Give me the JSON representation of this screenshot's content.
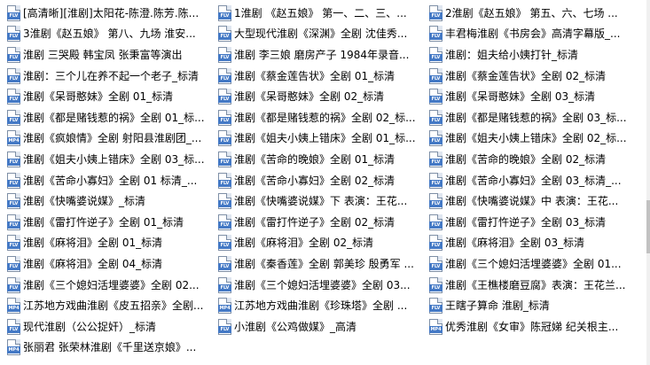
{
  "files": [
    {
      "name": "[高清晰][淮剧]太阳花-陈澄.陈芳.陈...",
      "type": "FLV"
    },
    {
      "name": "1淮剧 《赵五娘》 第一、二、三、...",
      "type": "FLV"
    },
    {
      "name": "2淮剧《赵五娘》 第五、六、七场 ...",
      "type": "FLV"
    },
    {
      "name": "3淮剧《赵五娘》 第八、九场 淮安...",
      "type": "FLV"
    },
    {
      "name": "大型现代淮剧《深渊》全剧 沈佳秀...",
      "type": "FLV"
    },
    {
      "name": "丰君梅淮剧《书房会》高清字幕版_...",
      "type": "FLV"
    },
    {
      "name": "淮剧 三哭殿 韩宝凤 张秉富等演出",
      "type": "FLV"
    },
    {
      "name": "淮剧 李三娘 磨房产子 1984年录音...",
      "type": "FLV"
    },
    {
      "name": "淮剧：姐夫给小姨打针_标清",
      "type": "FLV"
    },
    {
      "name": "淮剧：三个儿在养不起一个老子_标清",
      "type": "FLV"
    },
    {
      "name": "淮剧《蔡金莲告状》全剧 01_标清",
      "type": "FLV"
    },
    {
      "name": "淮剧《蔡金莲告状》全剧 02_标清",
      "type": "FLV"
    },
    {
      "name": "淮剧《呆哥憨妹》全剧 01_标清",
      "type": "FLV"
    },
    {
      "name": "淮剧《呆哥憨妹》全剧 02_标清",
      "type": "FLV"
    },
    {
      "name": "淮剧《呆哥憨妹》全剧 03_标清",
      "type": "FLV"
    },
    {
      "name": "淮剧《都是赌钱惹的祸》全剧 01_标...",
      "type": "FLV"
    },
    {
      "name": "淮剧《都是赌钱惹的祸》全剧 02_标...",
      "type": "FLV"
    },
    {
      "name": "淮剧《都是赌钱惹的祸》全剧 03_标...",
      "type": "FLV"
    },
    {
      "name": "淮剧《疯娘情》全剧 射阳县淮剧团_...",
      "type": "MP4"
    },
    {
      "name": "淮剧《姐夫小姨上错床》全剧 01_标...",
      "type": "FLV"
    },
    {
      "name": "淮剧《姐夫小姨上错床》全剧 02_标...",
      "type": "FLV"
    },
    {
      "name": "淮剧《姐夫小姨上错床》全剧 03_标...",
      "type": "FLV"
    },
    {
      "name": "淮剧《苦命的晚娘》全剧 01_标清",
      "type": "FLV"
    },
    {
      "name": "淮剧《苦命的晚娘》全剧 02_标清",
      "type": "FLV"
    },
    {
      "name": "淮剧《苦命小寡妇》全剧 01 标清_...",
      "type": "FLV"
    },
    {
      "name": "淮剧《苦命小寡妇》全剧 02_标清",
      "type": "FLV"
    },
    {
      "name": "淮剧《苦命小寡妇》全剧 03_标清_...",
      "type": "FLV"
    },
    {
      "name": "淮剧《快嘴婆说媒》_标清",
      "type": "FLV"
    },
    {
      "name": "淮剧《快嘴婆说媒》下 表演：王花...",
      "type": "FLV"
    },
    {
      "name": "淮剧《快嘴婆说媒》中 表演：王花...",
      "type": "FLV"
    },
    {
      "name": "淮剧《雷打忤逆子》全剧 01_标清",
      "type": "FLV"
    },
    {
      "name": "淮剧《雷打忤逆子》全剧 02_标清",
      "type": "FLV"
    },
    {
      "name": "淮剧《雷打忤逆子》全剧 03_标清",
      "type": "FLV"
    },
    {
      "name": "淮剧《麻将泪》全剧 01_标清",
      "type": "FLV"
    },
    {
      "name": "淮剧《麻将泪》全剧 02_标清",
      "type": "FLV"
    },
    {
      "name": "淮剧《麻将泪》全剧 03_标清",
      "type": "FLV"
    },
    {
      "name": "淮剧《麻将泪》全剧 04_标清",
      "type": "FLV"
    },
    {
      "name": "淮剧《秦香莲》全剧 郭美珍 殷勇军 ...",
      "type": "FLV"
    },
    {
      "name": "淮剧《三个媳妇活埋婆婆》全剧 01...",
      "type": "FLV"
    },
    {
      "name": "淮剧《三个媳妇活埋婆婆》全剧 02...",
      "type": "FLV"
    },
    {
      "name": "淮剧《三个媳妇活埋婆婆》全剧 03...",
      "type": "FLV"
    },
    {
      "name": "淮剧《王樵楼磨豆腐》表演：王花兰...",
      "type": "FLV"
    },
    {
      "name": "江苏地方戏曲淮剧《皮五招亲》全剧...",
      "type": "MP4"
    },
    {
      "name": "江苏地方戏曲淮剧《珍珠塔》全剧 ...",
      "type": "MP4"
    },
    {
      "name": "王瞎子算命 淮剧_标清",
      "type": "FLV"
    },
    {
      "name": "现代淮剧（公公捉奸）_标清",
      "type": "FLV"
    },
    {
      "name": "小淮剧《公鸡做媒》_高清",
      "type": "FLV"
    },
    {
      "name": "优秀淮剧《女审》陈冠娣 纪关根主...",
      "type": "MP4"
    },
    {
      "name": "张丽君 张荣林淮剧《千里送京娘》...",
      "type": "MP4"
    }
  ],
  "colors": {
    "icon_band": "#4479c5",
    "icon_border": "#7e8fa6",
    "background": "#ffffff"
  },
  "icon_names": {
    "FLV": "flv-file-icon",
    "MP4": "mp4-file-icon"
  }
}
